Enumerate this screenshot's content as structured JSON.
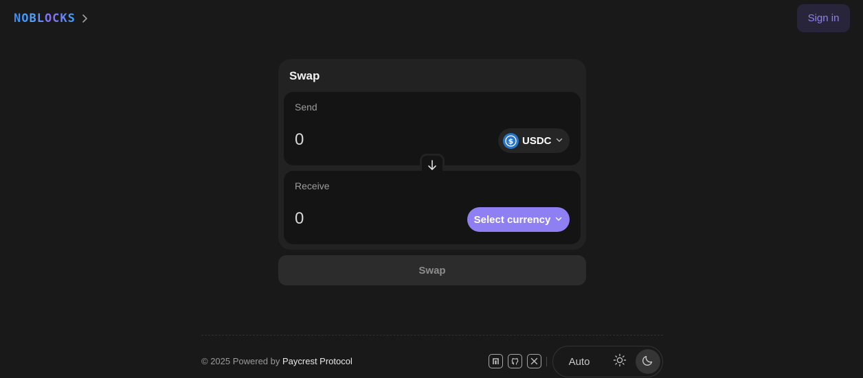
{
  "header": {
    "logo_text": "NOBLOCKS",
    "sign_in_label": "Sign in"
  },
  "swap": {
    "title": "Swap",
    "send": {
      "label": "Send",
      "amount": "0",
      "token": "USDC"
    },
    "receive": {
      "label": "Receive",
      "amount": "0",
      "select_label": "Select currency"
    },
    "submit_label": "Swap"
  },
  "footer": {
    "copyright": "© 2025 Powered by ",
    "brand": "Paycrest Protocol",
    "social_icons": [
      "noblocks-icon",
      "github-icon",
      "x-icon"
    ],
    "theme": {
      "auto_label": "Auto",
      "selected": "dark"
    }
  },
  "colors": {
    "background": "#191919",
    "card": "#222222",
    "panel": "#141414",
    "accent": "#8e7ff2",
    "sign_in_text": "#8b82f4",
    "usdc": "#2775ca"
  }
}
